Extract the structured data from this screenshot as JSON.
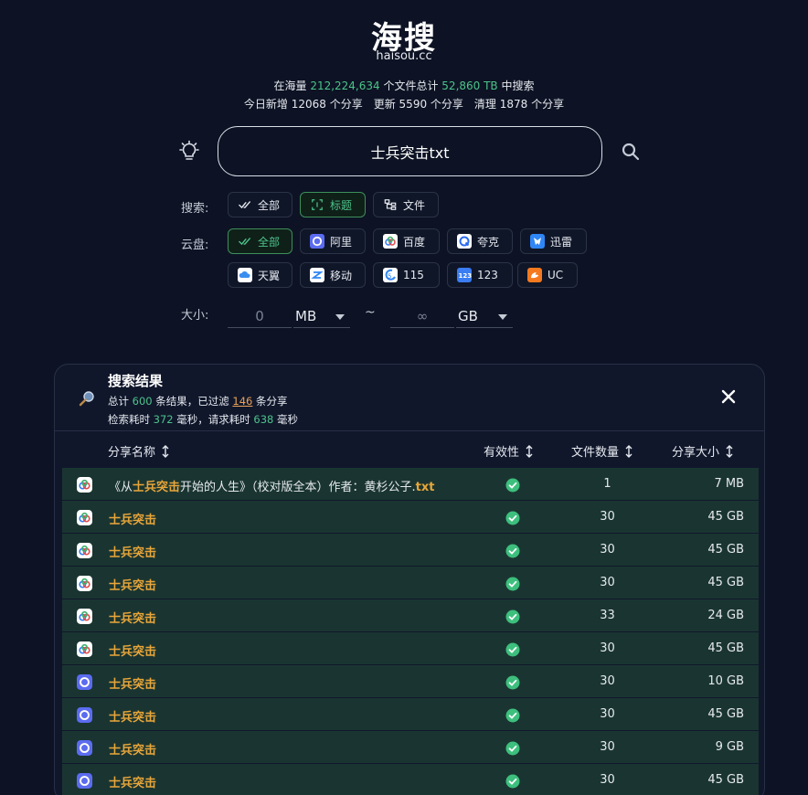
{
  "header": {
    "logo": "海搜",
    "domain": "haisou.cc",
    "stats_line1": {
      "prefix": "在海量 ",
      "total_files": "212,224,634",
      "mid": " 个文件总计 ",
      "total_size": "52,860 TB",
      "suffix": " 中搜索"
    },
    "stats_line2": {
      "new_label": "今日新增 12068 个分享",
      "updated_label": "更新 5590 个分享",
      "cleaned_label": "清理 1878 个分享"
    }
  },
  "search": {
    "value": "士兵突击txt"
  },
  "filters": {
    "search_label": "搜索:",
    "search_options": [
      {
        "label": "全部",
        "active": false
      },
      {
        "label": "标题",
        "active": true
      },
      {
        "label": "文件",
        "active": false
      }
    ],
    "cloud_label": "云盘:",
    "cloud_options": [
      {
        "label": "全部",
        "active": true
      },
      {
        "label": "阿里",
        "active": false
      },
      {
        "label": "百度",
        "active": false
      },
      {
        "label": "夸克",
        "active": false
      },
      {
        "label": "迅雷",
        "active": false
      },
      {
        "label": "天翼",
        "active": false
      },
      {
        "label": "移动",
        "active": false
      },
      {
        "label": "115",
        "active": false
      },
      {
        "label": "123",
        "active": false
      },
      {
        "label": "UC",
        "active": false
      }
    ],
    "size_label": "大小:",
    "size_min": "0",
    "size_min_unit": "MB",
    "size_sep": "~",
    "size_max": "∞",
    "size_max_unit": "GB"
  },
  "results": {
    "title": "搜索结果",
    "line1": {
      "a": "总计 ",
      "total": "600",
      "b": " 条结果，已过滤 ",
      "filtered": "146",
      "c": " 条分享"
    },
    "line2": {
      "a": "检索耗时 ",
      "search_ms": "372",
      "b": " 毫秒，请求耗时 ",
      "request_ms": "638",
      "c": " 毫秒"
    },
    "columns": {
      "name": "分享名称",
      "valid": "有效性",
      "count": "文件数量",
      "size": "分享大小"
    },
    "first_row": {
      "pre": "《从",
      "hl1": "士兵突击",
      "mid": "开始的人生》（校对版全本）作者：黄杉公子.",
      "hl2": "txt",
      "count": "1",
      "size": "7 MB"
    },
    "rows": [
      {
        "name": "士兵突击",
        "count": "30",
        "size": "45 GB"
      },
      {
        "name": "士兵突击",
        "count": "30",
        "size": "45 GB"
      },
      {
        "name": "士兵突击",
        "count": "30",
        "size": "45 GB"
      },
      {
        "name": "士兵突击",
        "count": "33",
        "size": "24 GB"
      },
      {
        "name": "士兵突击",
        "count": "30",
        "size": "45 GB"
      },
      {
        "name": "士兵突击",
        "count": "30",
        "size": "10 GB"
      },
      {
        "name": "士兵突击",
        "count": "30",
        "size": "45 GB"
      },
      {
        "name": "士兵突击",
        "count": "30",
        "size": "9 GB"
      },
      {
        "name": "士兵突击",
        "count": "30",
        "size": "45 GB"
      }
    ]
  },
  "colors": {
    "background": "#0d1324",
    "accent_green": "#4cc38a",
    "highlight_orange": "#e8a63a",
    "row_bg": "#1a3531"
  }
}
